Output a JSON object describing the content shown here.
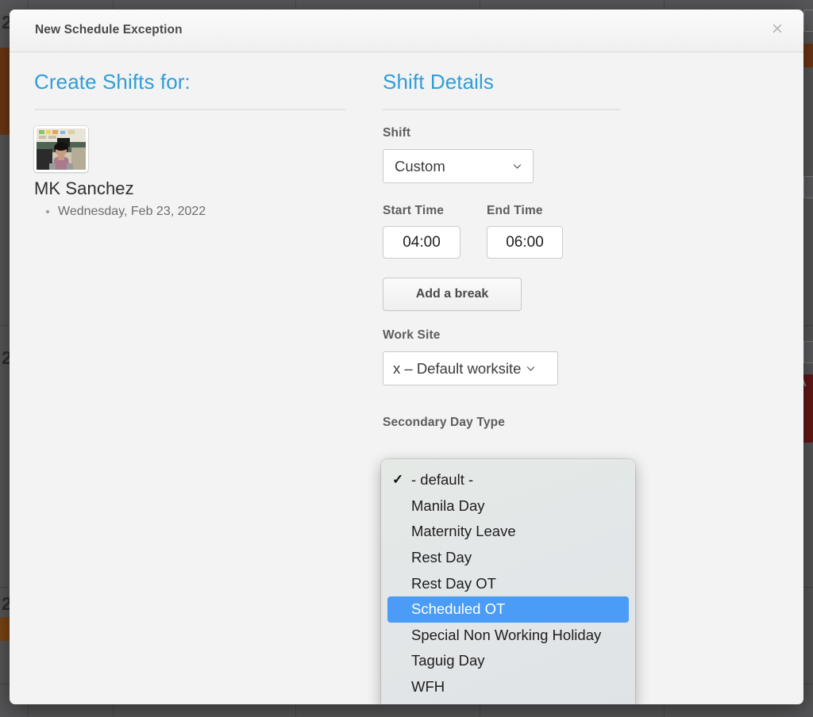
{
  "modal": {
    "title": "New Schedule Exception",
    "close_icon": "close-icon",
    "close_glyph": "×"
  },
  "left_panel": {
    "heading": "Create Shifts for:",
    "employee": {
      "avatar_alt": "employee-photo",
      "name": "MK Sanchez",
      "dates": [
        "Wednesday, Feb 23, 2022"
      ]
    }
  },
  "right_panel": {
    "heading": "Shift Details",
    "shift": {
      "label": "Shift",
      "value": "Custom"
    },
    "start_time": {
      "label": "Start Time",
      "value": "04:00"
    },
    "end_time": {
      "label": "End Time",
      "value": "06:00"
    },
    "add_break_button": "Add a break",
    "work_site": {
      "label": "Work Site",
      "value": "x – Default worksite"
    },
    "secondary_day_type": {
      "label": "Secondary Day Type",
      "checked_value": "- default -",
      "highlighted_value": "Scheduled OT",
      "options": [
        {
          "label": "- default -",
          "checked": true,
          "highlighted": false
        },
        {
          "label": "Manila Day",
          "checked": false,
          "highlighted": false
        },
        {
          "label": "Maternity Leave",
          "checked": false,
          "highlighted": false
        },
        {
          "label": "Rest Day",
          "checked": false,
          "highlighted": false
        },
        {
          "label": "Rest Day OT",
          "checked": false,
          "highlighted": false
        },
        {
          "label": "Scheduled OT",
          "checked": false,
          "highlighted": true
        },
        {
          "label": "Special Non Working Holiday",
          "checked": false,
          "highlighted": false
        },
        {
          "label": "Taguig Day",
          "checked": false,
          "highlighted": false
        },
        {
          "label": "WFH",
          "checked": false,
          "highlighted": false
        }
      ],
      "check_glyph": "✓"
    }
  },
  "background": {
    "hour_labels": [
      "2",
      "2",
      "2"
    ],
    "event_label": "A"
  },
  "colors": {
    "accent_heading": "#2f9fd8",
    "menu_highlight": "#4a9cf6",
    "modal_background": "#f3f3f3",
    "backdrop": "#565557"
  }
}
